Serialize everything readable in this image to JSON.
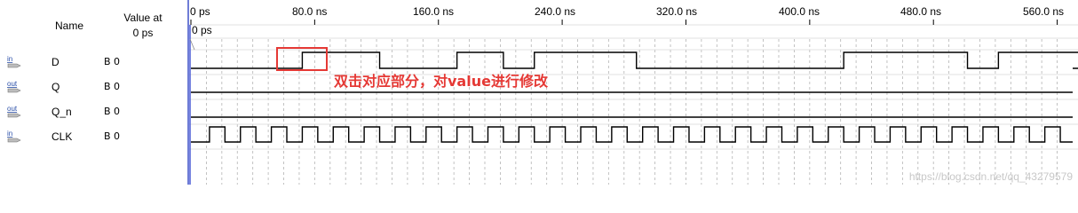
{
  "header": {
    "name_label": "Name",
    "value_label_line1": "Value at",
    "value_label_line2": "0 ps"
  },
  "signals": [
    {
      "icon": "input-pin-icon",
      "icon_text": "in",
      "name": "D",
      "value": "B 0"
    },
    {
      "icon": "output-pin-icon",
      "icon_text": "out",
      "name": "Q",
      "value": "B 0"
    },
    {
      "icon": "output-pin-icon",
      "icon_text": "out",
      "name": "Q_n",
      "value": "B 0"
    },
    {
      "icon": "input-pin-icon",
      "icon_text": "in",
      "name": "CLK",
      "value": "B 0"
    }
  ],
  "timeline": {
    "labels": [
      "0 ps",
      "80.0 ns",
      "160.0 ns",
      "240.0 ns",
      "320.0 ns",
      "400.0 ns",
      "480.0 ns",
      "560.0 ns"
    ],
    "cursor_label": "0 ps"
  },
  "waveforms": {
    "D_high_intervals_ns": [
      [
        72,
        122
      ],
      [
        172,
        202
      ],
      [
        222,
        288
      ],
      [
        422,
        502
      ],
      [
        522,
        652
      ]
    ],
    "Q_level": 0,
    "Q_n_level": 0,
    "CLK_period_ns": 20,
    "CLK_first_rise_ns": 12,
    "time_range_ns": [
      0,
      570
    ]
  },
  "annotation": {
    "text": "双击对应部分，对value进行修改",
    "color": "#e53935"
  },
  "watermark": "https://blog.csdn.net/qq_43279579",
  "colors": {
    "divider": "#6f7dd6",
    "wave": "#000000",
    "grid": "#b4b4b4"
  }
}
